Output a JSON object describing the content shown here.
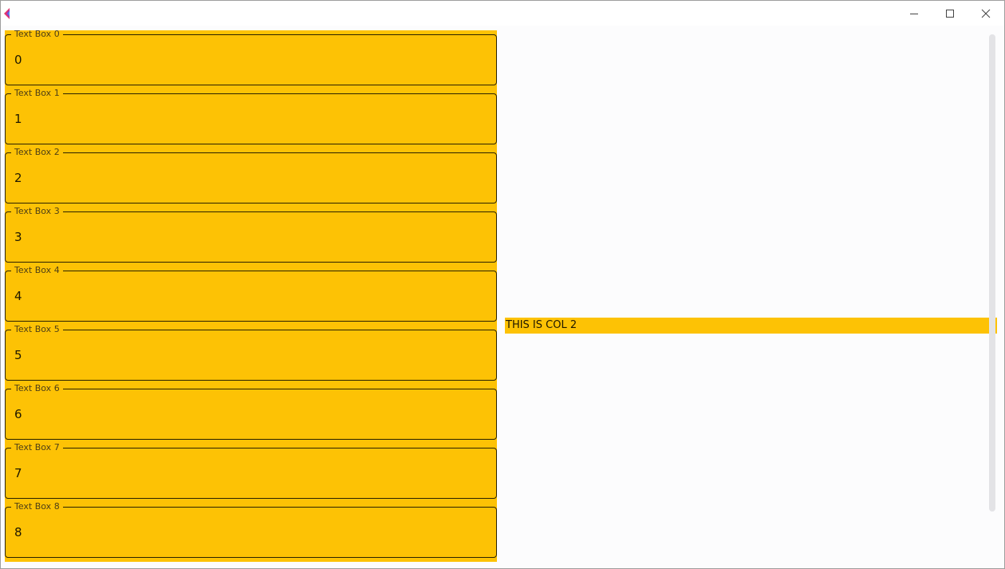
{
  "window": {
    "controls": {
      "minimize_icon": "minimize-icon",
      "maximize_icon": "maximize-icon",
      "close_icon": "close-icon"
    }
  },
  "column1": {
    "fields": [
      {
        "label": "Text Box 0",
        "value": "0"
      },
      {
        "label": "Text Box 1",
        "value": "1"
      },
      {
        "label": "Text Box 2",
        "value": "2"
      },
      {
        "label": "Text Box 3",
        "value": "3"
      },
      {
        "label": "Text Box 4",
        "value": "4"
      },
      {
        "label": "Text Box 5",
        "value": "5"
      },
      {
        "label": "Text Box 6",
        "value": "6"
      },
      {
        "label": "Text Box 7",
        "value": "7"
      },
      {
        "label": "Text Box 8",
        "value": "8"
      }
    ]
  },
  "column2": {
    "text": "THIS IS COL 2"
  },
  "colors": {
    "accent": "#fdc205",
    "background": "#fcfcfd",
    "border": "#2a2200"
  }
}
